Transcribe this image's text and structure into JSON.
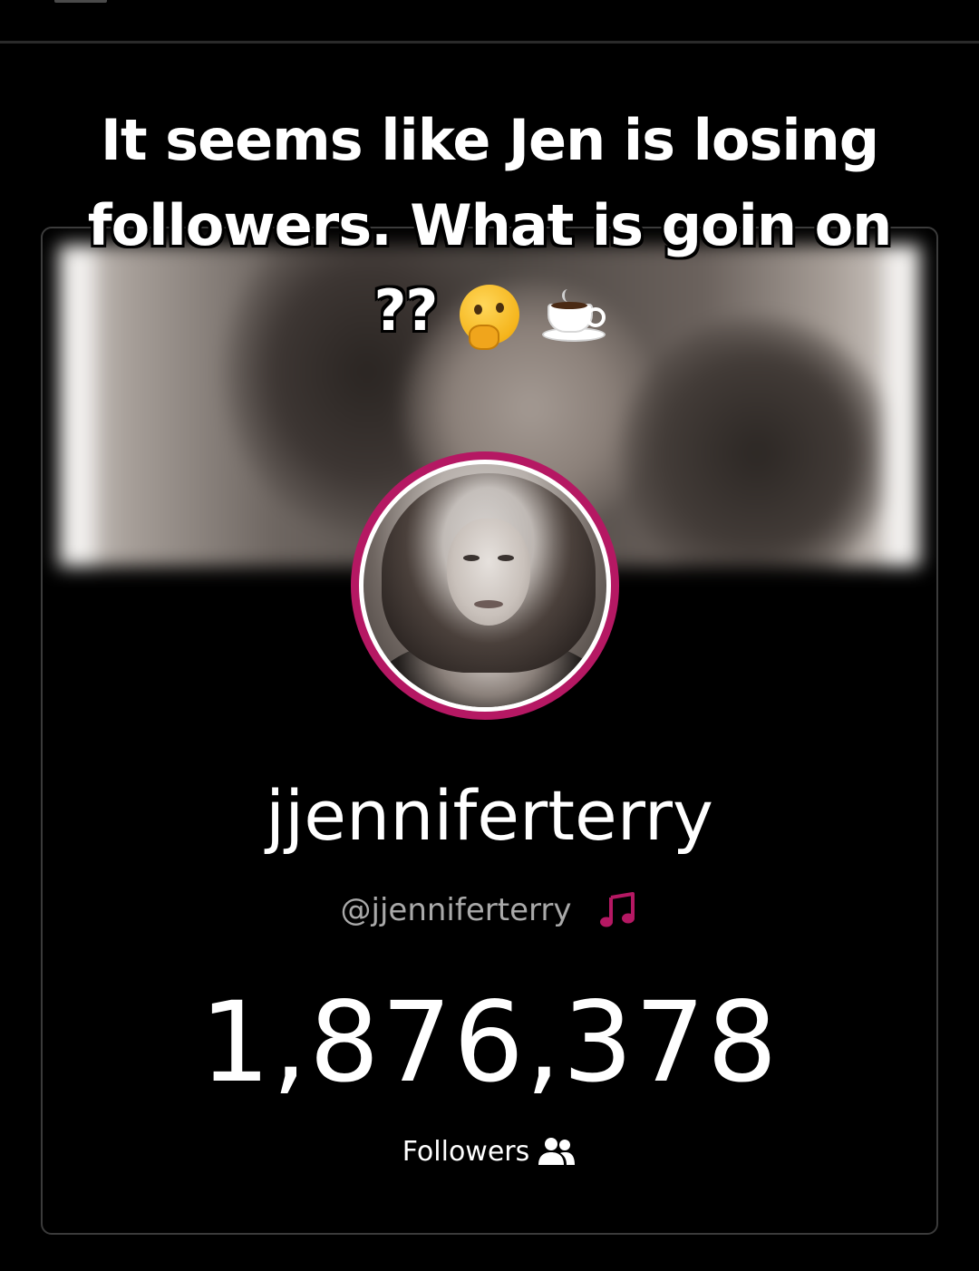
{
  "overlay": {
    "caption": "It seems like Jen is losing followers. What is goin on ??",
    "caption_emojis": [
      "thinking-face-icon",
      "coffee-cup-icon"
    ]
  },
  "profile": {
    "display_name": "jjenniferterry",
    "handle": "@jjenniferterry",
    "platform_icon": "music-note-icon",
    "follower_count": "1,876,378",
    "followers_label": "Followers",
    "followers_icon": "users-icon"
  },
  "colors": {
    "avatar_ring": "#b51863",
    "background": "#000000",
    "handle_text": "#a9a9a9",
    "music_icon": "#b51863"
  }
}
